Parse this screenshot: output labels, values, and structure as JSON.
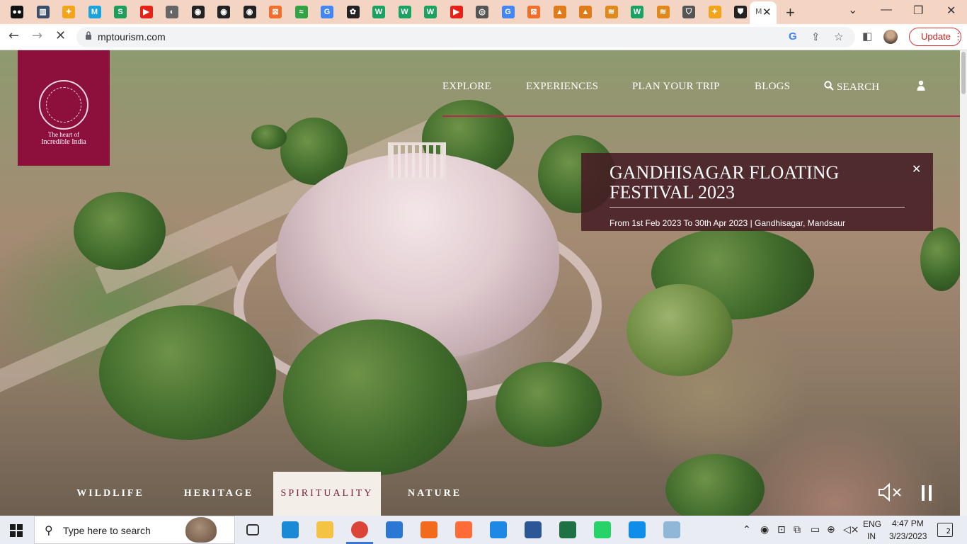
{
  "browser": {
    "active_tab_title": "M",
    "url": "mptourism.com",
    "update_label": "Update",
    "tab_icons": [
      {
        "name": "medium-icon",
        "color": "#111111",
        "glyph": "●●"
      },
      {
        "name": "reader-icon",
        "color": "#3b4d68",
        "glyph": "▥"
      },
      {
        "name": "flame-icon",
        "color": "#f2a51a",
        "glyph": "✦"
      },
      {
        "name": "m-icon",
        "color": "#1aa3dd",
        "glyph": "M"
      },
      {
        "name": "s-icon",
        "color": "#1e9e5a",
        "glyph": "S"
      },
      {
        "name": "youtube-icon",
        "color": "#e62117",
        "glyph": "▶"
      },
      {
        "name": "globe-icon",
        "color": "#666666",
        "glyph": "◐"
      },
      {
        "name": "github-icon",
        "color": "#222222",
        "glyph": "◉"
      },
      {
        "name": "github-icon",
        "color": "#222222",
        "glyph": "◉"
      },
      {
        "name": "github-icon",
        "color": "#222222",
        "glyph": "◉"
      },
      {
        "name": "box-icon",
        "color": "#f06f2b",
        "glyph": "⊠"
      },
      {
        "name": "graph-icon",
        "color": "#33a244",
        "glyph": "≈"
      },
      {
        "name": "google-icon",
        "color": "#4285f4",
        "glyph": "G"
      },
      {
        "name": "pie-icon",
        "color": "#222222",
        "glyph": "✿"
      },
      {
        "name": "w-icon",
        "color": "#1aa260",
        "glyph": "W"
      },
      {
        "name": "w-icon",
        "color": "#1aa260",
        "glyph": "W"
      },
      {
        "name": "w-icon",
        "color": "#1aa260",
        "glyph": "W"
      },
      {
        "name": "youtube-icon",
        "color": "#e62117",
        "glyph": "▶"
      },
      {
        "name": "chrome-icon",
        "color": "#555555",
        "glyph": "◎"
      },
      {
        "name": "google-icon",
        "color": "#4285f4",
        "glyph": "G"
      },
      {
        "name": "box-icon",
        "color": "#f06f2b",
        "glyph": "⊠"
      },
      {
        "name": "pma-icon",
        "color": "#e07b1a",
        "glyph": "▲"
      },
      {
        "name": "pma-icon",
        "color": "#e07b1a",
        "glyph": "▲"
      },
      {
        "name": "wave-icon",
        "color": "#e0891a",
        "glyph": "≋"
      },
      {
        "name": "w-icon",
        "color": "#1aa260",
        "glyph": "W"
      },
      {
        "name": "wave-icon",
        "color": "#e0891a",
        "glyph": "≋"
      },
      {
        "name": "shield-icon",
        "color": "#555555",
        "glyph": "⛉"
      },
      {
        "name": "flame-icon",
        "color": "#f2a51a",
        "glyph": "✦"
      },
      {
        "name": "shield-icon",
        "color": "#222222",
        "glyph": "⛊"
      }
    ]
  },
  "site": {
    "logo": {
      "line1": "The heart of",
      "line2": "Incredible India"
    },
    "nav": [
      "EXPLORE",
      "EXPERIENCES",
      "PLAN YOUR TRIP",
      "BLOGS"
    ],
    "search_label": "SEARCH",
    "event": {
      "title": "GANDHISAGAR FLOATING FESTIVAL 2023",
      "subtitle": "From 1st Feb 2023 To 30th Apr 2023 | Gandhisagar, Mandsaur"
    },
    "categories": [
      "WILDLIFE",
      "HERITAGE",
      "SPIRITUALITY",
      "NATURE"
    ],
    "active_category": "SPIRITUALITY",
    "accent": "#8d0f3b"
  },
  "taskbar": {
    "search_placeholder": "Type here to search",
    "lang_line1": "ENG",
    "lang_line2": "IN",
    "time": "4:47 PM",
    "date": "3/23/2023",
    "notification_count": "2",
    "apps": [
      {
        "name": "task-view-icon",
        "color": "#333333"
      },
      {
        "name": "edge-icon",
        "color": "#1b8ad6"
      },
      {
        "name": "file-explorer-icon",
        "color": "#f5c342"
      },
      {
        "name": "chrome-icon",
        "color": "#db4437"
      },
      {
        "name": "mail-icon",
        "color": "#2b78d4"
      },
      {
        "name": "xampp-icon",
        "color": "#f26b1d"
      },
      {
        "name": "postman-icon",
        "color": "#ff6c37"
      },
      {
        "name": "vscode-icon",
        "color": "#1e88e5"
      },
      {
        "name": "word-icon",
        "color": "#2b5797"
      },
      {
        "name": "excel-icon",
        "color": "#1e7145"
      },
      {
        "name": "whatsapp-icon",
        "color": "#25d366"
      },
      {
        "name": "teamviewer-icon",
        "color": "#0e8ee9"
      },
      {
        "name": "notes-icon",
        "color": "#8fb8d8"
      }
    ]
  }
}
